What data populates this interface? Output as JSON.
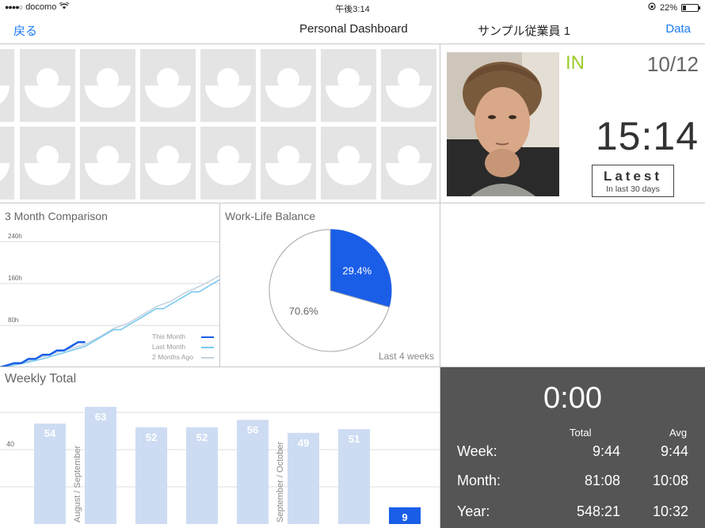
{
  "status_bar": {
    "carrier": "docomo",
    "time": "午後3:14",
    "battery": "22%"
  },
  "nav": {
    "back_label": "戻る",
    "title": "Personal Dashboard",
    "employee_name": "サンプル従業員 1",
    "data_label": "Data"
  },
  "profile": {
    "status": "IN",
    "date": "10/12",
    "time": "15:14",
    "latest_label": "Latest",
    "latest_sub": "In last 30 days",
    "status_color": "#9ccc2b"
  },
  "comparison": {
    "title": "3 Month Comparison",
    "legend": [
      {
        "label": "This Month",
        "color": "#1a5ee8"
      },
      {
        "label": "Last Month",
        "color": "#79c9ee"
      },
      {
        "label": "2 Months Ago",
        "color": "#c5d3e0"
      }
    ]
  },
  "worklife": {
    "title": "Work-Life Balance",
    "footer": "Last 4 weeks"
  },
  "weekly": {
    "title": "Weekly Total"
  },
  "summary": {
    "current": "0:00",
    "col_total": "Total",
    "col_avg": "Avg",
    "rows": [
      {
        "label": "Week:",
        "total": "9:44",
        "avg": "9:44"
      },
      {
        "label": "Month:",
        "total": "81:08",
        "avg": "10:08"
      },
      {
        "label": "Year:",
        "total": "548:21",
        "avg": "10:32"
      }
    ]
  },
  "chart_data": [
    {
      "type": "line",
      "title": "3 Month Comparison",
      "y_ticks": [
        "80h",
        "160h",
        "240h"
      ],
      "ylim": [
        0,
        260
      ],
      "xlim": [
        0,
        31
      ],
      "legend_position": "bottom-right",
      "series": [
        {
          "name": "This Month",
          "color": "#1a5ee8",
          "points": [
            [
              0,
              0
            ],
            [
              1,
              4
            ],
            [
              2,
              8
            ],
            [
              3,
              8
            ],
            [
              4,
              16
            ],
            [
              5,
              16
            ],
            [
              6,
              24
            ],
            [
              7,
              24
            ],
            [
              8,
              32
            ],
            [
              9,
              32
            ],
            [
              10,
              40
            ],
            [
              11,
              48
            ],
            [
              12,
              48
            ]
          ]
        },
        {
          "name": "Last Month",
          "color": "#79c9ee",
          "points": [
            [
              0,
              0
            ],
            [
              2,
              4
            ],
            [
              4,
              10
            ],
            [
              6,
              16
            ],
            [
              8,
              24
            ],
            [
              10,
              32
            ],
            [
              12,
              40
            ],
            [
              14,
              56
            ],
            [
              16,
              72
            ],
            [
              17,
              72
            ],
            [
              18,
              80
            ],
            [
              19,
              88
            ],
            [
              20,
              96
            ],
            [
              21,
              104
            ],
            [
              22,
              112
            ],
            [
              23,
              112
            ],
            [
              24,
              120
            ],
            [
              25,
              128
            ],
            [
              26,
              136
            ],
            [
              27,
              144
            ],
            [
              28,
              144
            ],
            [
              29,
              152
            ],
            [
              30,
              160
            ],
            [
              31,
              168
            ]
          ]
        },
        {
          "name": "2 Months Ago",
          "color": "#c5d3e0",
          "points": [
            [
              0,
              0
            ],
            [
              2,
              6
            ],
            [
              4,
              12
            ],
            [
              6,
              20
            ],
            [
              8,
              28
            ],
            [
              10,
              36
            ],
            [
              12,
              44
            ],
            [
              14,
              58
            ],
            [
              16,
              74
            ],
            [
              18,
              84
            ],
            [
              20,
              100
            ],
            [
              22,
              116
            ],
            [
              24,
              126
            ],
            [
              26,
              142
            ],
            [
              28,
              154
            ],
            [
              30,
              168
            ],
            [
              31,
              176
            ]
          ]
        }
      ]
    },
    {
      "type": "pie",
      "title": "Work-Life Balance",
      "slices": [
        {
          "label": "29.4%",
          "value": 29.4,
          "color": "#1a5ee8"
        },
        {
          "label": "70.6%",
          "value": 70.6,
          "color": "#ffffff"
        }
      ]
    },
    {
      "type": "bar",
      "title": "Weekly Total",
      "ylim": [
        0,
        80
      ],
      "y_ticks": [
        "40"
      ],
      "values": [
        54,
        63,
        52,
        52,
        56,
        49,
        51,
        9
      ],
      "current_index": 7,
      "bar_color": "#cddcf2",
      "current_color": "#1a5ee8",
      "separators": [
        {
          "after_index": 0,
          "label": "August / September"
        },
        {
          "after_index": 4,
          "label": "September / October"
        }
      ]
    }
  ]
}
